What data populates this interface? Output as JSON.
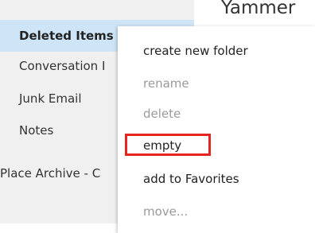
{
  "header": {
    "title": "Yammer"
  },
  "sidebar": {
    "items": [
      {
        "label": "Deleted Items",
        "selected": true
      },
      {
        "label": "Conversation I"
      },
      {
        "label": "Junk Email"
      },
      {
        "label": "Notes"
      },
      {
        "label": "Place Archive - C"
      }
    ]
  },
  "context_menu": {
    "items": [
      {
        "label": "create new folder",
        "enabled": true
      },
      {
        "label": "rename",
        "enabled": false
      },
      {
        "label": "delete",
        "enabled": false
      },
      {
        "label": "empty",
        "enabled": true,
        "highlighted": true
      },
      {
        "label": "add to Favorites",
        "enabled": true
      },
      {
        "label": "move...",
        "enabled": false
      }
    ]
  },
  "colors": {
    "sidebar_bg": "#f0f0f0",
    "selected_bg": "#cde5f7",
    "highlight_border": "#e5251f",
    "disabled_text": "#9a9a9a"
  }
}
